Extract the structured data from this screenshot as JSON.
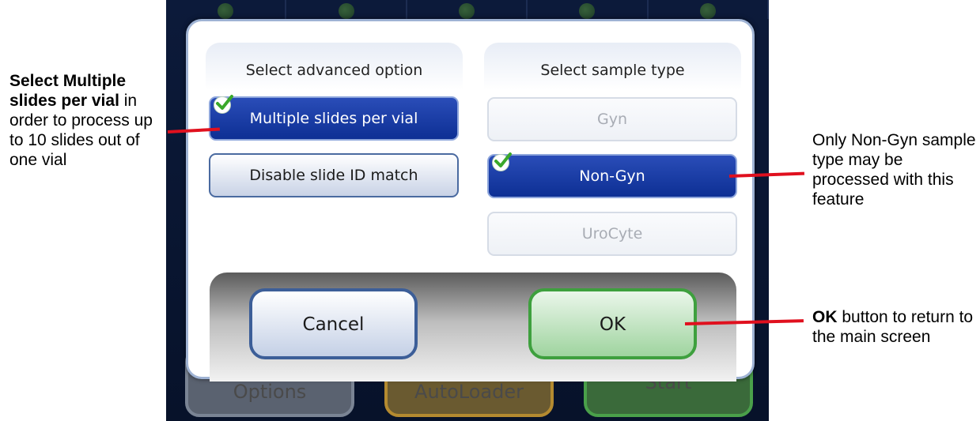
{
  "dialog": {
    "advanced_panel": {
      "title": "Select advanced option",
      "options": [
        {
          "label": "Multiple slides per vial",
          "state": "selected"
        },
        {
          "label": "Disable slide ID match",
          "state": "normal"
        }
      ]
    },
    "sample_panel": {
      "title": "Select sample type",
      "options": [
        {
          "label": "Gyn",
          "state": "disabled"
        },
        {
          "label": "Non-Gyn",
          "state": "selected"
        },
        {
          "label": "UroCyte",
          "state": "disabled"
        }
      ]
    },
    "cancel_label": "Cancel",
    "ok_label": "OK"
  },
  "background_buttons": {
    "options_label": "Options",
    "autoloader_label": "AutoLoader",
    "start_label": "Start"
  },
  "annotations": {
    "left": {
      "bold": "Select Multiple slides per vial",
      "rest": " in order to process up to 10 slides out of one vial"
    },
    "right_top": "Only Non-Gyn sample type may be processed with this feature",
    "right_bottom": {
      "bold": "OK",
      "rest": " button to return to the main screen"
    }
  },
  "colors": {
    "selected_blue": "#0d2f94",
    "ok_green": "#3ea03e",
    "callout_red": "#e0101e"
  },
  "icons": [
    "checkmark-icon"
  ]
}
